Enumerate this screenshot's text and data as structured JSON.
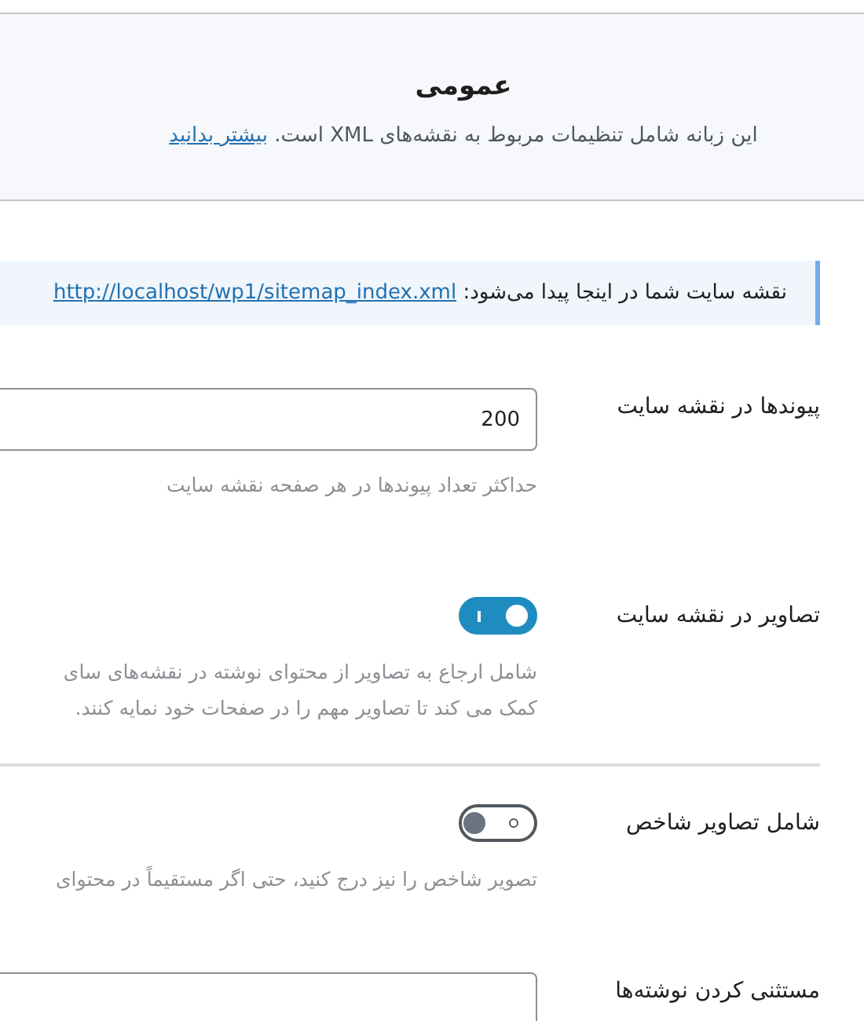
{
  "header": {
    "title": "عمومی",
    "description": "این زبانه شامل تنظیمات مربوط به نقشه‌های XML است.",
    "link": "بیشتر بدانید"
  },
  "notice": {
    "text": "نقشه سایت شما در اینجا پیدا می‌شود:",
    "link": "http://localhost/wp1/sitemap_index.xml"
  },
  "settings": [
    {
      "kind": "number",
      "label": "پیوندها در نقشه سایت",
      "value": "200",
      "help": [
        "حداکثر تعداد پیوندها در هر صفحه نقشه سایت"
      ]
    },
    {
      "kind": "toggle",
      "label": "تصاویر در نقشه سایت",
      "on": true,
      "help": [
        "شامل ارجاع به تصاویر از محتوای نوشته در نقشه‌های سای",
        "کمک می کند تا تصاویر مهم را در صفحات خود نمایه کنند."
      ]
    },
    {
      "kind": "toggle",
      "label": "شامل تصاویر شاخص",
      "on": false,
      "help": [
        "تصویر شاخص را نیز درج کنید، حتی اگر مستقیماً در محتوای"
      ]
    },
    {
      "kind": "text",
      "label": "مستثنی کردن نوشته‌ها"
    }
  ]
}
